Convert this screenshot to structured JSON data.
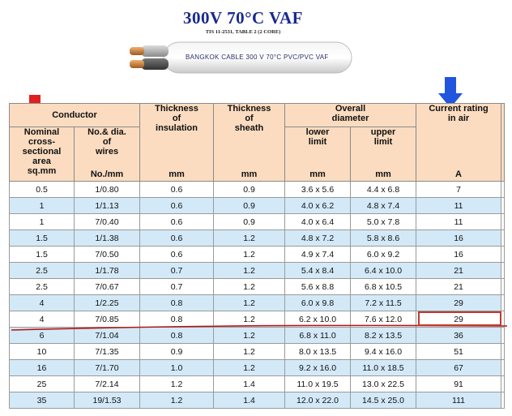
{
  "header": {
    "title": "300V 70°C VAF",
    "subtitle": "TIS 11-2531, TABLE 2 (2 CORE)",
    "cable_label": "BANGKOK CABLE 300 V 70°C PVC/PVC VAF"
  },
  "colors": {
    "title": "#1a2a8c",
    "header_fill": "#fbdcc0",
    "row_alt": "#d3e9f7",
    "arrow_red": "#e02020",
    "arrow_blue": "#2255dd",
    "highlight": "#c0392b"
  },
  "table": {
    "headers": {
      "conductor": "Conductor",
      "nominal_area": "Nominal cross-sectional area sq.mm",
      "nominal_area_lines": [
        "Nominal",
        "cross-",
        "sectional",
        "area",
        "sq.mm"
      ],
      "wires_lines": [
        "No.& dia.",
        "of",
        "wires"
      ],
      "wires_unit": "No./mm",
      "insulation_lines": [
        "Thickness",
        "of",
        "insulation"
      ],
      "insulation_unit": "mm",
      "sheath_lines": [
        "Thickness",
        "of",
        "sheath"
      ],
      "sheath_unit": "mm",
      "diameter_lines": [
        "Overall",
        "diameter"
      ],
      "lower_lines": [
        "lower",
        "limit"
      ],
      "lower_unit": "mm",
      "upper_lines": [
        "upper",
        "limit"
      ],
      "upper_unit": "mm",
      "current_lines": [
        "Current rating",
        "in air"
      ],
      "current_unit": "A"
    },
    "rows": [
      [
        "0.5",
        "1/0.80",
        "0.6",
        "0.9",
        "3.6 x 5.6",
        "4.4 x 6.8",
        "7"
      ],
      [
        "1",
        "1/1.13",
        "0.6",
        "0.9",
        "4.0 x 6.2",
        "4.8 x 7.4",
        "11"
      ],
      [
        "1",
        "7/0.40",
        "0.6",
        "0.9",
        "4.0 x 6.4",
        "5.0 x 7.8",
        "11"
      ],
      [
        "1.5",
        "1/1.38",
        "0.6",
        "1.2",
        "4.8 x 7.2",
        "5.8 x 8.6",
        "16"
      ],
      [
        "1.5",
        "7/0.50",
        "0.6",
        "1.2",
        "4.9 x 7.4",
        "6.0 x 9.2",
        "16"
      ],
      [
        "2.5",
        "1/1.78",
        "0.7",
        "1.2",
        "5.4 x 8.4",
        "6.4 x 10.0",
        "21"
      ],
      [
        "2.5",
        "7/0.67",
        "0.7",
        "1.2",
        "5.6 x 8.8",
        "6.8 x 10.5",
        "21"
      ],
      [
        "4",
        "1/2.25",
        "0.8",
        "1.2",
        "6.0 x 9.8",
        "7.2 x 11.5",
        "29"
      ],
      [
        "4",
        "7/0.85",
        "0.8",
        "1.2",
        "6.2 x 10.0",
        "7.6 x 12.0",
        "29"
      ],
      [
        "6",
        "7/1.04",
        "0.8",
        "1.2",
        "6.8 x 11.0",
        "8.2 x 13.5",
        "36"
      ],
      [
        "10",
        "7/1.35",
        "0.9",
        "1.2",
        "8.0 x 13.5",
        "9.4 x 16.0",
        "51"
      ],
      [
        "16",
        "7/1.70",
        "1.0",
        "1.2",
        "9.2 x 16.0",
        "11.0 x 18.5",
        "67"
      ],
      [
        "25",
        "7/2.14",
        "1.2",
        "1.4",
        "11.0 x 19.5",
        "13.0 x 22.5",
        "91"
      ],
      [
        "35",
        "19/1.53",
        "1.2",
        "1.4",
        "12.0 x 22.0",
        "14.5 x 25.0",
        "111"
      ]
    ],
    "highlighted_row": 8
  }
}
